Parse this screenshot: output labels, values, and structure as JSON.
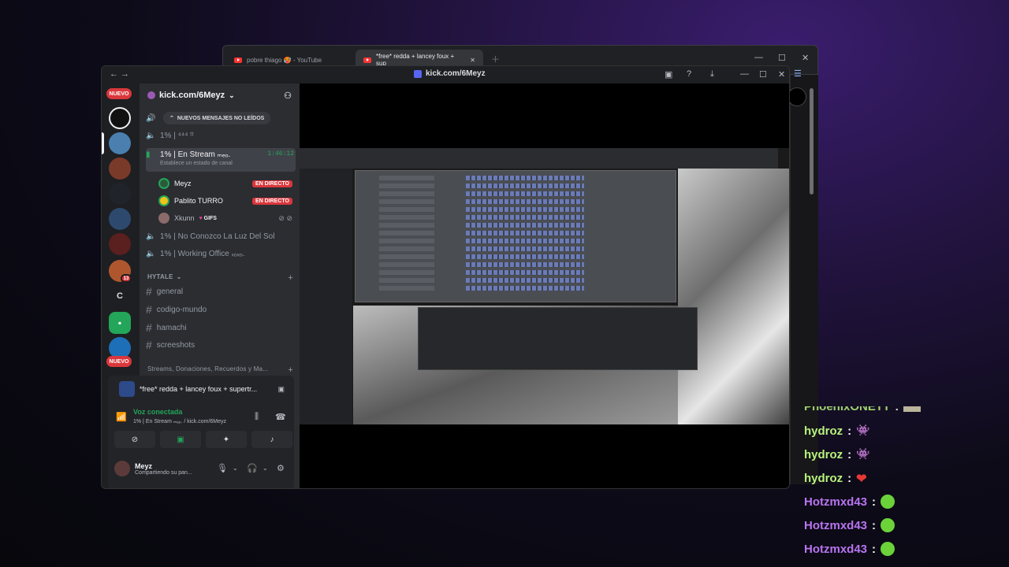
{
  "browser": {
    "tabs": [
      {
        "label": "pobre thiago 🥵 - YouTube"
      },
      {
        "label": "*free* redda + lancey foux + sup"
      }
    ]
  },
  "discord": {
    "title": "kick.com/6Meyz",
    "badge_new": "NUEVO",
    "badge_new_2": "NUEVO",
    "server_count": "13",
    "server_letter": "C",
    "server_name": "kick.com/6Meyz",
    "new_messages": "NUEVOS MENSAJES NO LEÍDOS",
    "voice_channels": [
      {
        "name": "1% | ⁴⁴⁴ ᵗᵗ"
      },
      {
        "name": "1% | En Stream ₘₑₒ.",
        "status": "Establece un estado de canal",
        "timer": "1:46:12"
      },
      {
        "name": "1% | No Conozco La Luz Del Sol"
      },
      {
        "name": "1% | Working Office ₓₒₓₒ."
      }
    ],
    "users": [
      {
        "name": "Meyz",
        "live": "EN DIRECTO"
      },
      {
        "name": "Pablito TURRO",
        "live": "EN DIRECTO"
      },
      {
        "name": "Xkunn",
        "tag": "GIFS"
      }
    ],
    "category": "HYTALE",
    "text_channels": [
      "general",
      "codigo-mundo",
      "hamachi",
      "screeshots"
    ],
    "category2": "Streams, Donaciones, Recuerdos y Ma...",
    "activity": "*free* redda + lancey foux + supertr...",
    "voice_connected": "Voz conectada",
    "voice_location": "1% | En Stream ₘₑₒ. / kick.com/6Meyz",
    "me": {
      "name": "Meyz",
      "status": "Compartiendo su pan..."
    }
  },
  "chat": [
    {
      "user": "PhoenixONETT",
      "sep": " :",
      "color": "#b9f27c"
    },
    {
      "user": "hydroz",
      "sep": " :",
      "color": "#b9f27c"
    },
    {
      "user": "hydroz",
      "sep": " :",
      "color": "#b9f27c"
    },
    {
      "user": "hydroz",
      "sep": " :",
      "color": "#b9f27c"
    },
    {
      "user": "Hotzmxd43",
      "sep": " :",
      "color": "#b874f0"
    },
    {
      "user": "Hotzmxd43",
      "sep": " :",
      "color": "#b874f0"
    },
    {
      "user": "Hotzmxd43",
      "sep": " :",
      "color": "#b874f0"
    }
  ],
  "colors": {
    "live": "#da373c",
    "green": "#23a55a",
    "blurple": "#5865f2"
  }
}
